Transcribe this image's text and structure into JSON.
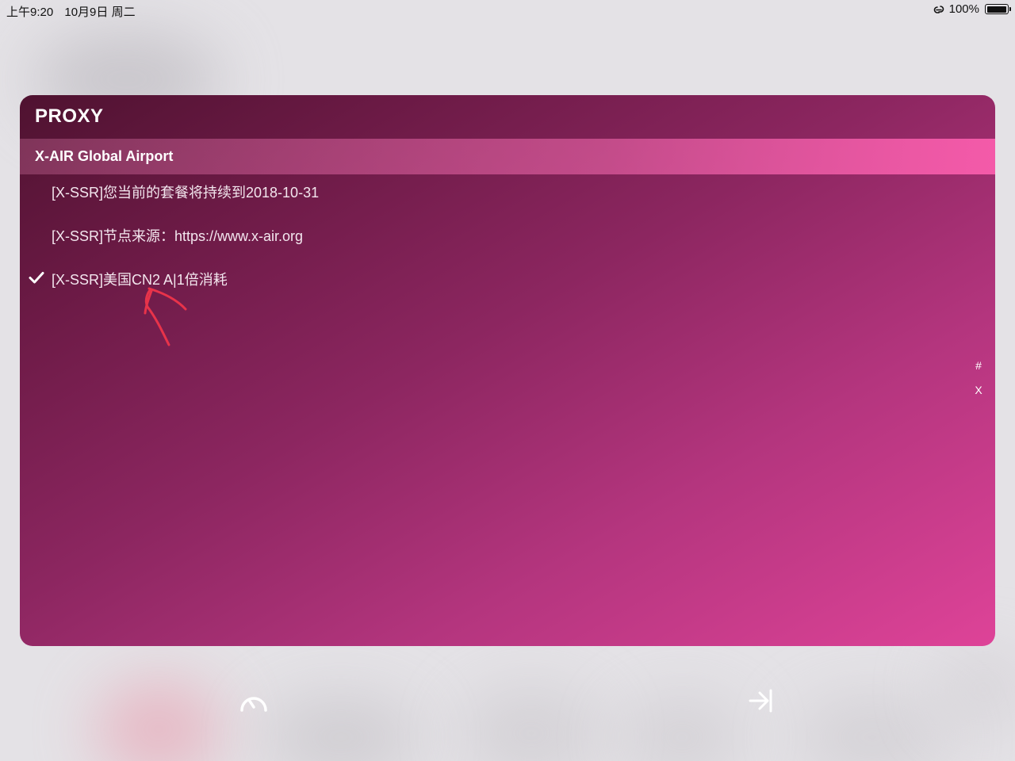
{
  "status_bar": {
    "time": "上午9:20",
    "date": "10月9日 周二",
    "battery_text": "100%",
    "link_icon": "link-icon",
    "battery_icon": "battery-icon",
    "battery_level": 1.0
  },
  "widget": {
    "title": "PROXY",
    "group": {
      "name": "X-AIR Global Airport"
    },
    "items": [
      {
        "label": "[X-SSR]您当前的套餐将持续到2018-10-31",
        "selected": false
      },
      {
        "label": "[X-SSR]节点来源：https://www.x-air.org",
        "selected": false
      },
      {
        "label": "[X-SSR]美国CN2 A|1倍消耗",
        "selected": true
      }
    ],
    "index_bar": [
      "#",
      "X"
    ],
    "check_icon": "checkmark-icon"
  },
  "annotation": {
    "icon": "red-arrow-annotation"
  },
  "controls": {
    "speed_test_icon": "speedometer-icon",
    "skip_icon": "skip-to-end-icon"
  },
  "colors": {
    "panel_gradient_start": "#4f1230",
    "panel_gradient_end": "#de4398",
    "group_highlight": "#f45aa9",
    "annotation_red": "#e8334a",
    "background": "#e4e2e6"
  }
}
